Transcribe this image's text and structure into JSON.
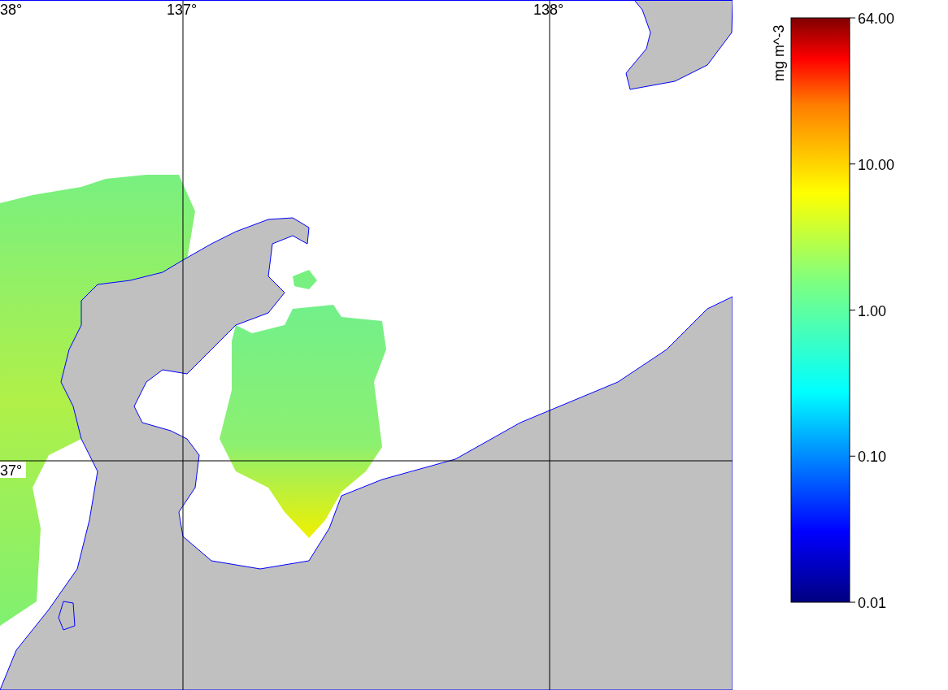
{
  "map": {
    "latitude_labels": [
      "38°",
      "37°"
    ],
    "longitude_labels": [
      "137°",
      "138°"
    ]
  },
  "colorbar": {
    "unit": "mg m^-3",
    "ticks": [
      "64.00",
      "10.00",
      "1.00",
      "0.10",
      "0.01"
    ]
  }
}
